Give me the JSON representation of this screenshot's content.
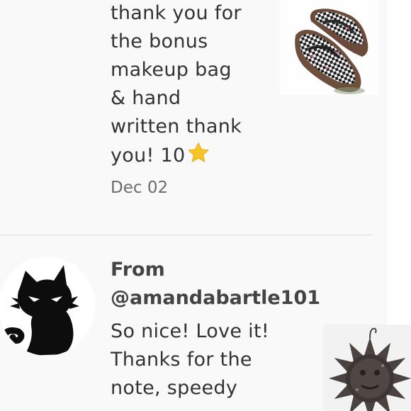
{
  "review_1": {
    "text": "thank you for\nthe bonus\nmakeup bag\n& hand\nwritten thank\nyou! 10",
    "star_icon": "star-icon",
    "date": "Dec 02",
    "thumbnail_icon": "checkered-shoes-photo"
  },
  "review_2": {
    "from_label": "From",
    "handle": "@amandabartle101",
    "text": "So nice! Love it!\nThanks for the\nnote, speedy",
    "avatar_icon": "angry-black-cat-avatar",
    "thumbnail_icon": "metal-sun-decor-photo"
  },
  "colors": {
    "text": "#333333",
    "muted": "#6b6b6b",
    "divider": "#dcdcdc",
    "background": "#f9f9f9"
  }
}
